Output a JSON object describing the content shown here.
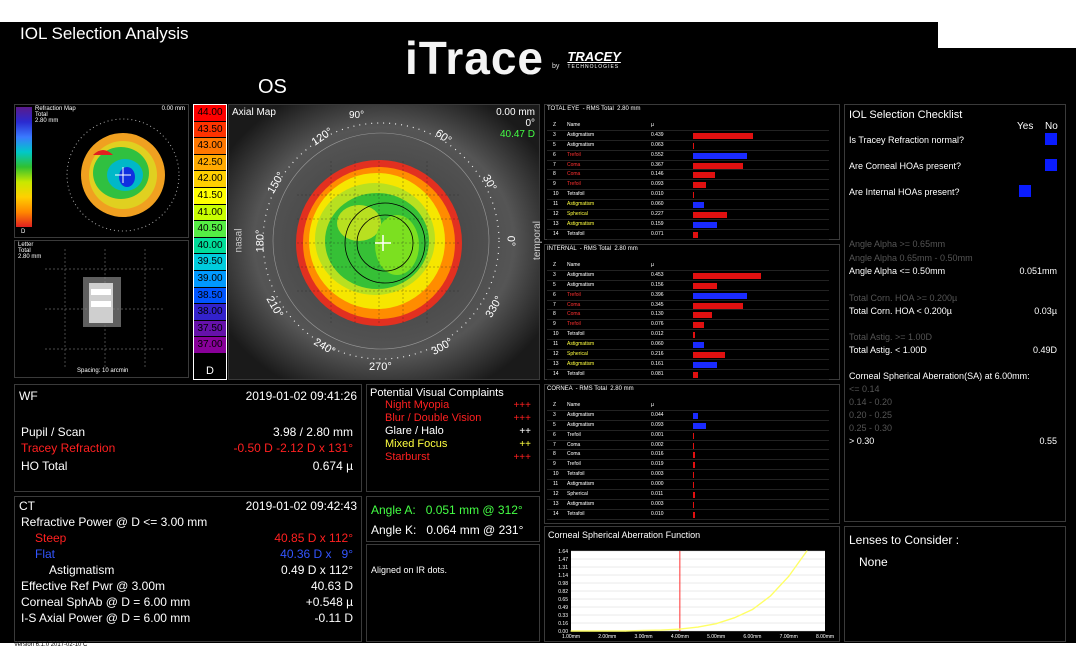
{
  "header": {
    "title": "IOL Selection Analysis",
    "logo_text": "iTrace",
    "logo_by": "by",
    "logo_company": "TRACEY",
    "logo_company_sub": "TECHNOLOGIES",
    "eye": "OS"
  },
  "refraction_map": {
    "title": "Refraction Map",
    "sub1": "Total",
    "sub2": "2.80 mm",
    "dist": "0.00 mm",
    "corner": "D"
  },
  "letter": {
    "title": "Letter",
    "sub1": "Total",
    "sub2": "2.80 mm",
    "spacing": "Spacing: 10 arcmin"
  },
  "axial_scale": [
    "44.00",
    "43.50",
    "43.00",
    "42.50",
    "42.00",
    "41.50",
    "41.00",
    "40.50",
    "40.00",
    "39.50",
    "39.00",
    "38.50",
    "38.00",
    "37.50",
    "37.00"
  ],
  "axial_scale_colors": [
    "#ff0000",
    "#ff3300",
    "#ff7700",
    "#ffaa00",
    "#ffd000",
    "#ffff00",
    "#c8ff00",
    "#55ee44",
    "#00dd99",
    "#00ccdd",
    "#0099ff",
    "#0055ff",
    "#3322cc",
    "#6611aa",
    "#880099"
  ],
  "axial_scale_unit": "D",
  "axial_map": {
    "title": "Axial Map",
    "top_angle": "90°",
    "dist": "0.00 mm",
    "deg": "0°",
    "power": "40.47 D",
    "nasal": "nasal",
    "temporal": "temporal",
    "angles": [
      "120°",
      "60°",
      "150°",
      "30°",
      "180°",
      "0°",
      "210°",
      "330°",
      "240°",
      "300°",
      "270°"
    ]
  },
  "zernike": [
    {
      "title": "TOTAL EYE  - RMS Total  2.80 mm",
      "header": [
        "Z",
        "Name",
        "µ"
      ],
      "rows": [
        {
          "n": "3",
          "name": "Astigmatism",
          "v": "0.439",
          "c": "w",
          "bar": 0.75,
          "bc": "red"
        },
        {
          "n": "5",
          "name": "Astigmatism",
          "v": "0.063",
          "c": "w",
          "bar": 0.0,
          "bc": "red"
        },
        {
          "n": "6",
          "name": "Trefoil",
          "v": "0.552",
          "c": "r",
          "bar": 0.68,
          "bc": "blue"
        },
        {
          "n": "7",
          "name": "Coma",
          "v": "0.367",
          "c": "r",
          "bar": 0.62,
          "bc": "red"
        },
        {
          "n": "8",
          "name": "Coma",
          "v": "0.146",
          "c": "r",
          "bar": 0.28,
          "bc": "red"
        },
        {
          "n": "9",
          "name": "Trefoil",
          "v": "0.093",
          "c": "r",
          "bar": 0.16,
          "bc": "red"
        },
        {
          "n": "10",
          "name": "Tetrafoil",
          "v": "0.010",
          "c": "w",
          "bar": 0.0,
          "bc": "red"
        },
        {
          "n": "11",
          "name": "Astigmatism",
          "v": "0.060",
          "c": "y",
          "bar": 0.14,
          "bc": "blue"
        },
        {
          "n": "12",
          "name": "Spherical",
          "v": "0.227",
          "c": "y",
          "bar": 0.42,
          "bc": "red"
        },
        {
          "n": "13",
          "name": "Astigmatism",
          "v": "0.159",
          "c": "y",
          "bar": 0.3,
          "bc": "blue"
        },
        {
          "n": "14",
          "name": "Tetrafoil",
          "v": "0.071",
          "c": "w",
          "bar": 0.06,
          "bc": "red"
        }
      ]
    },
    {
      "title": "INTERNAL  - RMS Total  2.80 mm",
      "header": [
        "Z",
        "Name",
        "µ"
      ],
      "rows": [
        {
          "n": "3",
          "name": "Astigmatism",
          "v": "0.453",
          "c": "w",
          "bar": 0.85,
          "bc": "red"
        },
        {
          "n": "5",
          "name": "Astigmatism",
          "v": "0.156",
          "c": "w",
          "bar": 0.3,
          "bc": "red"
        },
        {
          "n": "6",
          "name": "Trefoil",
          "v": "0.396",
          "c": "r",
          "bar": 0.68,
          "bc": "blue"
        },
        {
          "n": "7",
          "name": "Coma",
          "v": "0.345",
          "c": "r",
          "bar": 0.62,
          "bc": "red"
        },
        {
          "n": "8",
          "name": "Coma",
          "v": "0.130",
          "c": "r",
          "bar": 0.24,
          "bc": "red"
        },
        {
          "n": "9",
          "name": "Trefoil",
          "v": "0.076",
          "c": "r",
          "bar": 0.14,
          "bc": "red"
        },
        {
          "n": "10",
          "name": "Tetrafoil",
          "v": "0.012",
          "c": "w",
          "bar": 0.02,
          "bc": "red"
        },
        {
          "n": "11",
          "name": "Astigmatism",
          "v": "0.060",
          "c": "y",
          "bar": 0.14,
          "bc": "blue"
        },
        {
          "n": "12",
          "name": "Spherical",
          "v": "0.216",
          "c": "y",
          "bar": 0.4,
          "bc": "red"
        },
        {
          "n": "13",
          "name": "Astigmatism",
          "v": "0.161",
          "c": "y",
          "bar": 0.3,
          "bc": "blue"
        },
        {
          "n": "14",
          "name": "Tetrafoil",
          "v": "0.081",
          "c": "w",
          "bar": 0.06,
          "bc": "red"
        }
      ]
    },
    {
      "title": "CORNEA  - RMS Total  2.80 mm",
      "header": [
        "Z",
        "Name",
        "µ"
      ],
      "rows": [
        {
          "n": "3",
          "name": "Astigmatism",
          "v": "0.044",
          "c": "w",
          "bar": 0.06,
          "bc": "blue"
        },
        {
          "n": "5",
          "name": "Astigmatism",
          "v": "0.093",
          "c": "w",
          "bar": 0.16,
          "bc": "blue"
        },
        {
          "n": "6",
          "name": "Trefoil",
          "v": "0.001",
          "c": "w",
          "bar": 0.0,
          "bc": "red"
        },
        {
          "n": "7",
          "name": "Coma",
          "v": "0.002",
          "c": "w",
          "bar": 0.0,
          "bc": "red"
        },
        {
          "n": "8",
          "name": "Coma",
          "v": "0.016",
          "c": "w",
          "bar": 0.03,
          "bc": "red"
        },
        {
          "n": "9",
          "name": "Trefoil",
          "v": "0.019",
          "c": "w",
          "bar": 0.03,
          "bc": "red"
        },
        {
          "n": "10",
          "name": "Tetrafoil",
          "v": "0.003",
          "c": "w",
          "bar": 0.0,
          "bc": "red"
        },
        {
          "n": "11",
          "name": "Astigmatism",
          "v": "0.000",
          "c": "w",
          "bar": 0.0,
          "bc": "red"
        },
        {
          "n": "12",
          "name": "Spherical",
          "v": "0.011",
          "c": "w",
          "bar": 0.02,
          "bc": "red"
        },
        {
          "n": "13",
          "name": "Astigmatism",
          "v": "0.003",
          "c": "w",
          "bar": 0.0,
          "bc": "red"
        },
        {
          "n": "14",
          "name": "Tetrafoil",
          "v": "0.010",
          "c": "w",
          "bar": 0.02,
          "bc": "red"
        }
      ]
    }
  ],
  "checklist": {
    "title": "IOL Selection Checklist",
    "yes": "Yes",
    "no": "No",
    "q1": "Is Tracey Refraction normal?",
    "q2": "Are Corneal HOAs present?",
    "q3": "Are Internal HOAs present?",
    "alpha1": "Angle Alpha >= 0.65mm",
    "alpha2": "Angle Alpha  0.65mm - 0.50mm",
    "alpha3": "Angle Alpha <= 0.50mm",
    "alpha_val": "0.051mm",
    "hoa1": "Total Corn. HOA >= 0.200µ",
    "hoa2": "Total Corn. HOA < 0.200µ",
    "hoa_val": "0.03µ",
    "astig1": "Total Astig. >= 1.00D",
    "astig2": "Total Astig. < 1.00D",
    "astig_val": "0.49D",
    "sa_title": "Corneal Spherical Aberration(SA) at 6.00mm:",
    "sa1": "<= 0.14",
    "sa2": "0.14 - 0.20",
    "sa3": "0.20 - 0.25",
    "sa4": "0.25 - 0.30",
    "sa5": "> 0.30",
    "sa_val": "0.55"
  },
  "wf": {
    "title": "WF",
    "date": "2019-01-02  09:41:26",
    "pupil_label": "Pupil / Scan",
    "pupil_val": "3.98 / 2.80 mm",
    "tracey_label": "Tracey Refraction",
    "tracey_val": "-0.50 D -2.12 D x 131°",
    "ho_label": "HO Total",
    "ho_val": "0.674 µ"
  },
  "complaints": {
    "title": "Potential Visual Complaints",
    "items": [
      {
        "label": "Night Myopia",
        "val": "+++",
        "c": "r"
      },
      {
        "label": "Blur / Double Vision",
        "val": "+++",
        "c": "r"
      },
      {
        "label": "Glare / Halo",
        "val": "++",
        "c": "w"
      },
      {
        "label": "Mixed Focus",
        "val": "++",
        "c": "y"
      },
      {
        "label": "Starburst",
        "val": "+++",
        "c": "r"
      }
    ]
  },
  "ct": {
    "title": "CT",
    "date": "2019-01-02  09:42:43",
    "rp_label": "Refractive Power @ D <= 3.00 mm",
    "steep_label": "Steep",
    "steep_val": "40.85 D x 112°",
    "flat_label": "Flat",
    "flat_val": "40.36 D x   9°",
    "astig_label": "Astigmatism",
    "astig_val": "0.49 D x 112°",
    "erp_label": "Effective Ref Pwr @ 3.00m",
    "erp_val": "40.63 D",
    "sph_label": "Corneal SphAb @ D = 6.00 mm",
    "sph_val": "+0.548 µ",
    "is_label": "I-S Axial Power @ D = 6.00 mm",
    "is_val": "-0.11 D"
  },
  "angles": {
    "angle_a": "Angle A:   0.051 mm @ 312°",
    "angle_k": "Angle K:   0.064 mm @ 231°",
    "note": "Aligned on IR dots."
  },
  "sa_chart_title": "Corneal Spherical Aberration Function",
  "lenses": {
    "title": "Lenses to Consider :",
    "value": "None"
  },
  "version": "Version 6.1.0 2017-02-10 C",
  "chart_data": {
    "type": "line",
    "title": "Corneal Spherical Aberration Function",
    "x": [
      1.0,
      1.5,
      2.0,
      2.5,
      3.0,
      3.5,
      4.0,
      4.5,
      5.0,
      5.5,
      6.0,
      6.5,
      7.0,
      7.5
    ],
    "values": [
      0.0,
      0.0,
      0.0,
      0.0,
      0.01,
      0.02,
      0.04,
      0.08,
      0.15,
      0.27,
      0.44,
      0.72,
      1.12,
      1.64
    ],
    "x_ticks": [
      "1.00mm",
      "2.00mm",
      "3.00mm",
      "4.00mm",
      "5.00mm",
      "6.00mm",
      "7.00mm",
      "8.00mm"
    ],
    "y_ticks": [
      "1.64",
      "1.47",
      "1.31",
      "1.14",
      "0.98",
      "0.82",
      "0.65",
      "0.49",
      "0.33",
      "0.16",
      "0.00"
    ],
    "xlim": [
      1.0,
      8.0
    ],
    "ylim": [
      0.0,
      1.64
    ],
    "marker_x": 4.0,
    "line_color": "#ffff66",
    "marker_color": "#ff3030"
  }
}
